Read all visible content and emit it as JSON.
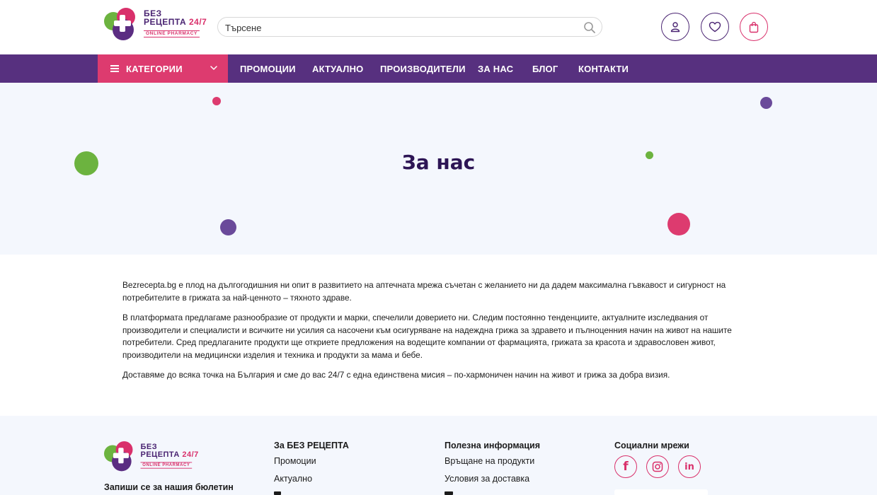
{
  "header": {
    "logo": {
      "line1": "БЕЗ",
      "line2": "РЕЦЕПТА",
      "line2_num": "24/7",
      "tagline": "ONLINE PHARMACY"
    },
    "search": {
      "placeholder": "Търсене"
    },
    "icons": [
      "user-icon",
      "heart-icon",
      "cart-icon"
    ]
  },
  "nav": {
    "categories_label": "КАТЕГОРИИ",
    "links": [
      "ПРОМОЦИИ",
      "АКТУАЛНО",
      "ПРОИЗВОДИТЕЛИ",
      "ЗА НАС",
      "БЛОГ",
      "КОНТАКТИ"
    ]
  },
  "hero": {
    "title": "За нас"
  },
  "content": {
    "paragraphs": [
      "Bezrecepta.bg е плод на дългогодишния ни опит в развитието на аптечната мрежа съчетан с желанието ни да дадем максимална гъвкавост и сигурност на потребителите в грижата за най-ценното – тяхното здраве.",
      "В платформата  предлагаме разнообразие от продукти и марки, спечелили доверието ни. Следим  постоянно тенденциите, актуалните изследвания от производители и специалисти и всичките ни усилия са насочени към осигуряване на надеждна грижа за здравето и пълноценния начин на живот на нашите потребители. Сред предлаганите продукти ще откриете предложения на водещите компании от фармацията, грижата за красота и здравословен живот, производители на медицински изделия и техника и продукти за мама и бебе.",
      "Доставяме до всяка точка на България и сме до вас 24/7 с една единствена мисия – по-хармоничен начин на живот и грижа за добра визия."
    ]
  },
  "footer": {
    "logo": {
      "line1": "БЕЗ",
      "line2": "РЕЦЕПТА",
      "line2_num": "24/7",
      "tagline": "ONLINE PHARMACY"
    },
    "newsletter_title": "Запиши се за нашия бюлетин",
    "col1": {
      "title": "За БЕЗ РЕЦЕПТА",
      "links": [
        "Промоции",
        "Актуално"
      ]
    },
    "col2": {
      "title": "Полезна информация",
      "links": [
        "Връщане на продукти",
        "Условия за доставка"
      ]
    },
    "col3": {
      "title": "Социални мрежи",
      "networks": [
        "facebook-icon",
        "instagram-icon",
        "linkedin-icon"
      ]
    }
  },
  "colors": {
    "brand_purple": "#57307f",
    "brand_pink": "#dd3b6f",
    "brand_green": "#6cb33f",
    "hero_bg": "#f4f7fd",
    "title_dark": "#2d1555"
  }
}
